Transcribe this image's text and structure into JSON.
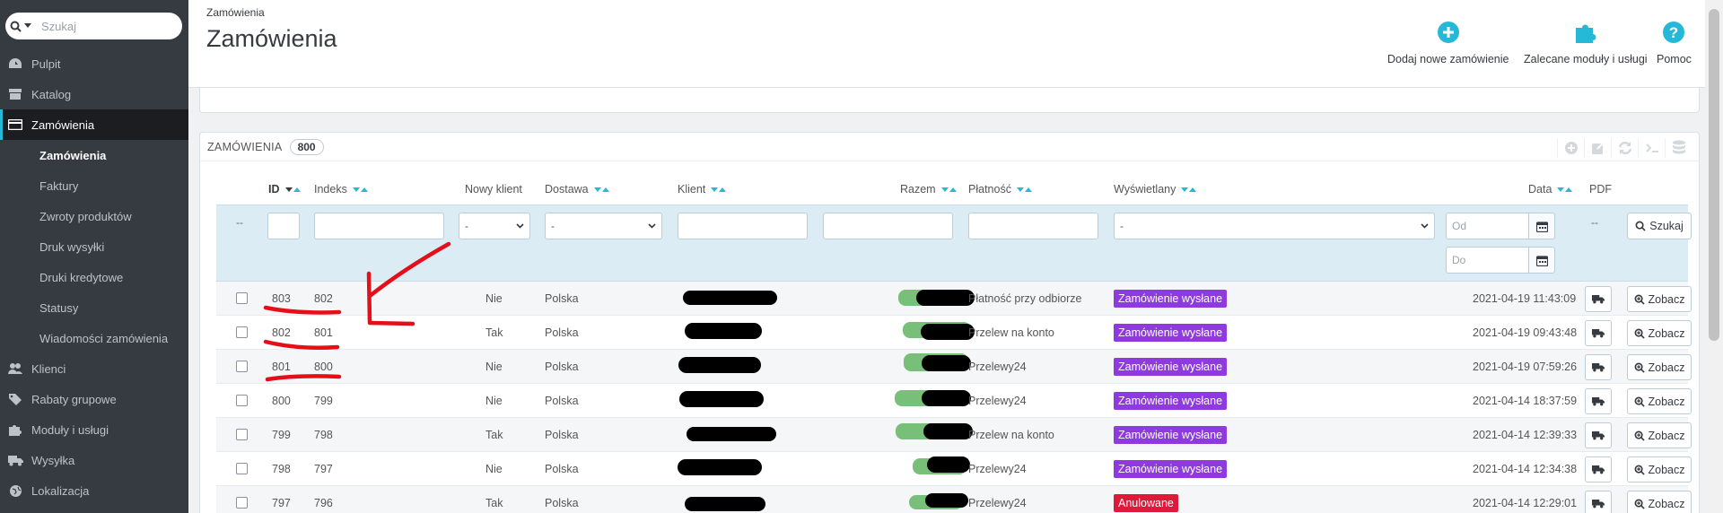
{
  "search": {
    "placeholder": "Szukaj"
  },
  "sidebar": {
    "items": [
      {
        "label": "Pulpit",
        "icon": "dashboard-icon"
      },
      {
        "label": "Katalog",
        "icon": "store-icon"
      },
      {
        "label": "Zamówienia",
        "icon": "credit-card-icon",
        "active": true
      },
      {
        "label": "Klienci",
        "icon": "users-icon"
      },
      {
        "label": "Rabaty grupowe",
        "icon": "tag-icon"
      },
      {
        "label": "Moduły i usługi",
        "icon": "puzzle-icon"
      },
      {
        "label": "Wysyłka",
        "icon": "truck-icon"
      },
      {
        "label": "Lokalizacja",
        "icon": "globe-icon"
      }
    ],
    "subitems": [
      "Zamówienia",
      "Faktury",
      "Zwroty produktów",
      "Druk wysyłki",
      "Druki kredytowe",
      "Statusy",
      "Wiadomości zamówienia"
    ]
  },
  "header": {
    "breadcrumb": "Zamówienia",
    "title": "Zamówienia",
    "buttons": {
      "add": "Dodaj nowe zamówienie",
      "modules": "Zalecane moduły i usługi",
      "help": "Pomoc"
    }
  },
  "panel": {
    "title": "ZAMÓWIENIA",
    "count": "800"
  },
  "table": {
    "headers": {
      "id": "ID",
      "index": "Indeks",
      "new_client": "Nowy klient",
      "delivery": "Dostawa",
      "client": "Klient",
      "total": "Razem",
      "payment": "Płatność",
      "displayed": "Wyświetlany",
      "date": "Data",
      "pdf": "PDF"
    },
    "filters": {
      "dash": "--",
      "select_default": "-",
      "date_from": "Od",
      "date_to": "Do",
      "search_button": "Szukaj"
    },
    "view_label": "Zobacz",
    "rows": [
      {
        "id": "803",
        "index": "802",
        "new": "Nie",
        "delivery": "Polska",
        "payment": "Płatność przy odbiorze",
        "status": "Zamówienie wysłane",
        "date": "2021-04-19 11:43:09"
      },
      {
        "id": "802",
        "index": "801",
        "new": "Tak",
        "delivery": "Polska",
        "payment": "Przelew na konto",
        "status": "Zamówienie wysłane",
        "date": "2021-04-19 09:43:48"
      },
      {
        "id": "801",
        "index": "800",
        "new": "Nie",
        "delivery": "Polska",
        "payment": "Przelewy24",
        "status": "Zamówienie wysłane",
        "date": "2021-04-19 07:59:26"
      },
      {
        "id": "800",
        "index": "799",
        "new": "Nie",
        "delivery": "Polska",
        "payment": "Przelewy24",
        "status": "Zamówienie wysłane",
        "date": "2021-04-14 18:37:59"
      },
      {
        "id": "799",
        "index": "798",
        "new": "Tak",
        "delivery": "Polska",
        "payment": "Przelew na konto",
        "status": "Zamówienie wysłane",
        "date": "2021-04-14 12:39:33"
      },
      {
        "id": "798",
        "index": "797",
        "new": "Nie",
        "delivery": "Polska",
        "payment": "Przelewy24",
        "status": "Zamówienie wysłane",
        "date": "2021-04-14 12:34:38"
      },
      {
        "id": "797",
        "index": "796",
        "new": "Tak",
        "delivery": "Polska",
        "payment": "Przelewy24",
        "status": "Anulowane",
        "date": "2021-04-14 12:29:01"
      }
    ]
  },
  "colors": {
    "sidebar": "#363a41",
    "accent": "#25b9d7",
    "sent": "#8e3ae0",
    "cancelled": "#e0193b",
    "annotation": "#e3101a"
  }
}
